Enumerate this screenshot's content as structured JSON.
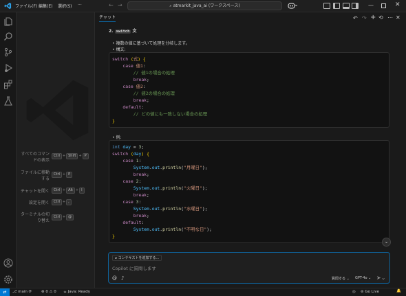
{
  "menu": {
    "file": "ファイル(F)",
    "edit": "編集(E)",
    "selection": "選択(S)",
    "more": "···"
  },
  "command_center": {
    "title": "atmarkit_java_ai (ワークスペース)"
  },
  "shortcuts": [
    {
      "label1": "すべてのコマン",
      "label2": "ドの表示",
      "keys": [
        "Ctrl",
        "Shift",
        "P"
      ]
    },
    {
      "label1": "ファイルに移動",
      "label2": "する",
      "keys": [
        "Ctrl",
        "P"
      ]
    },
    {
      "label1": "チャットを開く",
      "label2": "",
      "keys": [
        "Ctrl",
        "Alt",
        "I"
      ]
    },
    {
      "label1": "設定を開く",
      "label2": "",
      "keys": [
        "Ctrl",
        ","
      ]
    },
    {
      "label1": "ターミナルの切",
      "label2": "り替え",
      "keys": [
        "Ctrl",
        "@"
      ]
    }
  ],
  "chat": {
    "tab": "チャット",
    "heading_num": "2.",
    "heading_code": "switch",
    "heading_text": "文",
    "bullet1": "複数の値に基づいて処理を分岐します。",
    "bullet2": "構文:",
    "bullet3": "例:",
    "syntax_lines": [
      "switch (式) {",
      "    case 値1:",
      "        // 値1の場合の処理",
      "        break;",
      "    case 値2:",
      "        // 値2の場合の処理",
      "        break;",
      "    default:",
      "        // どの値にも一致しない場合の処理",
      "}"
    ],
    "example_lines": [
      "int day = 3;",
      "switch (day) {",
      "    case 1:",
      "        System.out.println(\"月曜日\");",
      "        break;",
      "    case 2:",
      "        System.out.println(\"火曜日\");",
      "        break;",
      "    case 3:",
      "        System.out.println(\"水曜日\");",
      "        break;",
      "    default:",
      "        System.out.println(\"不明な日\");",
      "}"
    ],
    "context_button": "コンテキストを追加する...",
    "input_placeholder": "Copilot に質問します",
    "mode": "質問する ⌄",
    "model": "GPT-4o ⌄"
  },
  "status": {
    "branch": "main",
    "errors": "0",
    "warnings": "0",
    "java": "Java: Ready",
    "golive": "Go Live"
  },
  "colors": {
    "accent": "#0e639c",
    "background": "#1e1e1e",
    "remote": "#0078d4"
  }
}
